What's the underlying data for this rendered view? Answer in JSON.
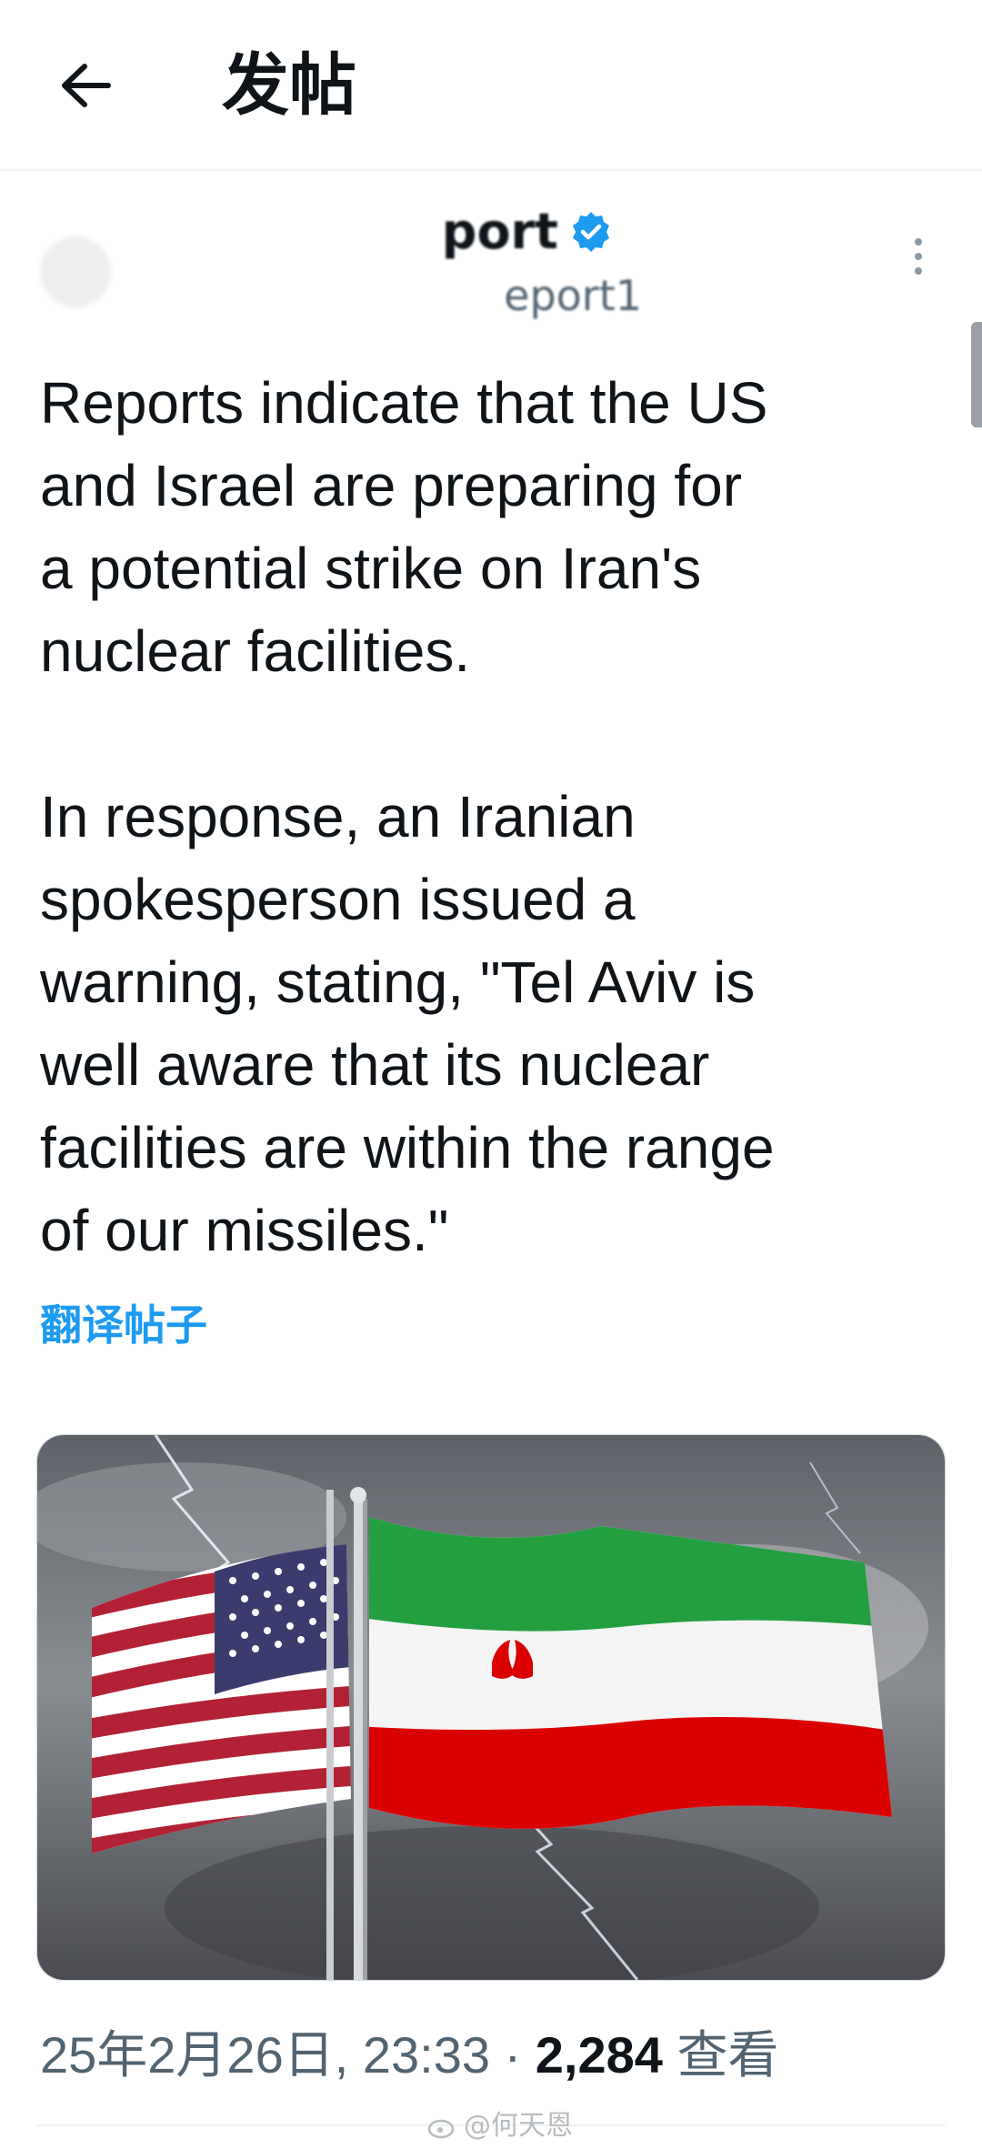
{
  "header": {
    "title": "发帖",
    "back_icon": "arrow-left-icon"
  },
  "author": {
    "name_fragment": "port",
    "handle_fragment": "eport1",
    "verified_icon": "verified-badge-icon",
    "verified_color": "#1d9bf0"
  },
  "post": {
    "paragraph_1": "Reports indicate that the US\nand Israel are preparing for\na potential strike on Iran's\nnuclear facilities.",
    "paragraph_2": "In response, an Iranian\nspokesperson issued a\nwarning, stating, \"Tel Aviv is\nwell aware that its nuclear\nfacilities are within the range\nof our missiles.\"",
    "translate_label": "翻译帖子",
    "image_alt": "US and Iran flags with lightning"
  },
  "meta": {
    "timestamp": "25年2月26日, 23:33",
    "separator": "·",
    "views_count": "2,284",
    "views_label": "查看"
  },
  "watermark": {
    "text": "@何天恩"
  },
  "colors": {
    "accent": "#1d9bf0",
    "secondary_text": "#536471",
    "text": "#0f1419"
  }
}
